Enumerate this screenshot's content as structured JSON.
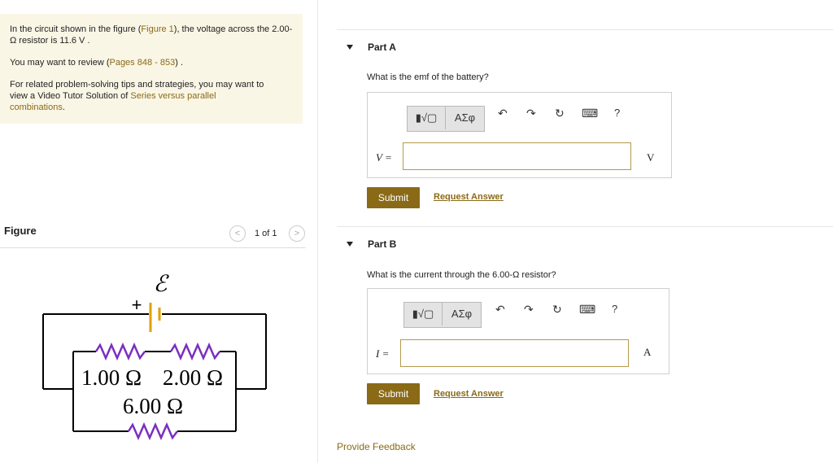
{
  "info": {
    "line1": "In the circuit shown in the figure (",
    "figure_link": "Figure 1",
    "line1_end": "), the voltage across the 2.00-",
    "line2": "Ω resistor is 11.6 V .",
    "review_pre": "You may want to review (",
    "review_link": "Pages 848 - 853",
    "review_post": ") .",
    "tips_line1": "For related problem-solving tips and strategies, you may want to",
    "tips_line2_pre": "view a Video Tutor Solution of ",
    "tips_link_a": "Series versus parallel",
    "tips_link_b": "combinations",
    "tips_end": "."
  },
  "figure": {
    "title": "Figure",
    "prev": "<",
    "next": ">",
    "pager": "1 of 1",
    "circuit": {
      "emf_symbol": "ℰ",
      "plus": "+",
      "r1": "1.00 Ω",
      "r2": "2.00 Ω",
      "r3": "6.00 Ω"
    }
  },
  "toolbar": {
    "templates": "▮√▢",
    "symbols": "ΑΣφ",
    "undo": "↶",
    "redo": "↷",
    "reset": "↻",
    "keyboard": "⌨",
    "help": "?"
  },
  "partA": {
    "title": "Part A",
    "question": "What is the emf of the battery?",
    "var": "V =",
    "unit": "V",
    "submit": "Submit",
    "request": "Request Answer"
  },
  "partB": {
    "title": "Part B",
    "question": "What is the current through the 6.00-Ω resistor?",
    "var": "I =",
    "unit": "A",
    "submit": "Submit",
    "request": "Request Answer"
  },
  "feedback": "Provide Feedback",
  "colors": {
    "accent": "#8a6a16",
    "info_bg": "#faf6e6",
    "resistor": "#7b2fbf"
  }
}
